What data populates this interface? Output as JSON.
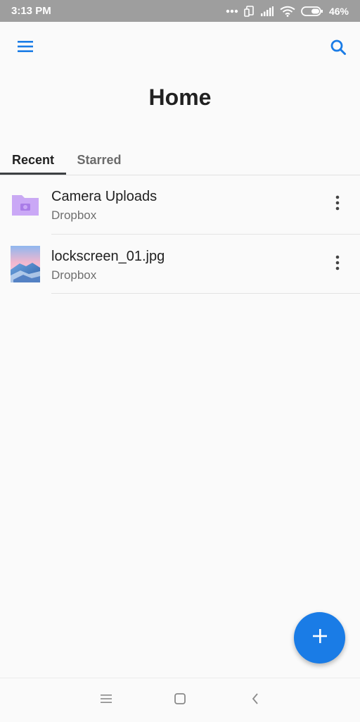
{
  "status_bar": {
    "time": "3:13 PM",
    "battery": "46%"
  },
  "header": {
    "title": "Home",
    "menu_icon": "hamburger-menu-icon",
    "search_icon": "search-icon"
  },
  "tabs": [
    {
      "label": "Recent",
      "active": true
    },
    {
      "label": "Starred",
      "active": false
    }
  ],
  "files": [
    {
      "name": "Camera Uploads",
      "location": "Dropbox",
      "icon": "camera-folder-icon"
    },
    {
      "name": "lockscreen_01.jpg",
      "location": "Dropbox",
      "icon": "image-thumbnail"
    }
  ],
  "fab": {
    "icon": "plus-icon"
  },
  "colors": {
    "accent": "#1a7ce6",
    "status_bar": "#9e9e9e",
    "folder": "#c9a9f3"
  }
}
